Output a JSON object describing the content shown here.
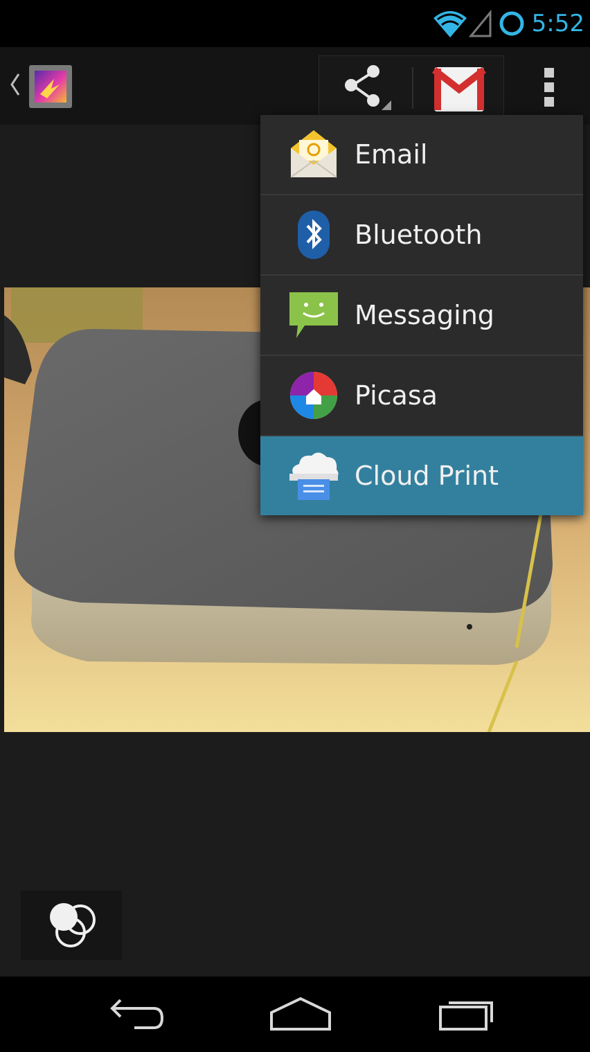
{
  "status": {
    "time": "5:52",
    "accent": "#33b5e5"
  },
  "actionbar": {
    "app_icon": "gallery-icon",
    "share_icon": "share-icon",
    "gmail_icon": "gmail-icon",
    "overflow_icon": "overflow-menu-icon"
  },
  "share_menu": {
    "items": [
      {
        "label": "Email",
        "icon": "email-icon"
      },
      {
        "label": "Bluetooth",
        "icon": "bluetooth-icon"
      },
      {
        "label": "Messaging",
        "icon": "messaging-icon"
      },
      {
        "label": "Picasa",
        "icon": "picasa-icon"
      },
      {
        "label": "Cloud Print",
        "icon": "cloud-print-icon",
        "selected": true
      }
    ],
    "selected_color": "#33809e"
  },
  "navbar": {
    "back_icon": "back-icon",
    "home_icon": "home-icon",
    "recents_icon": "recents-icon"
  }
}
